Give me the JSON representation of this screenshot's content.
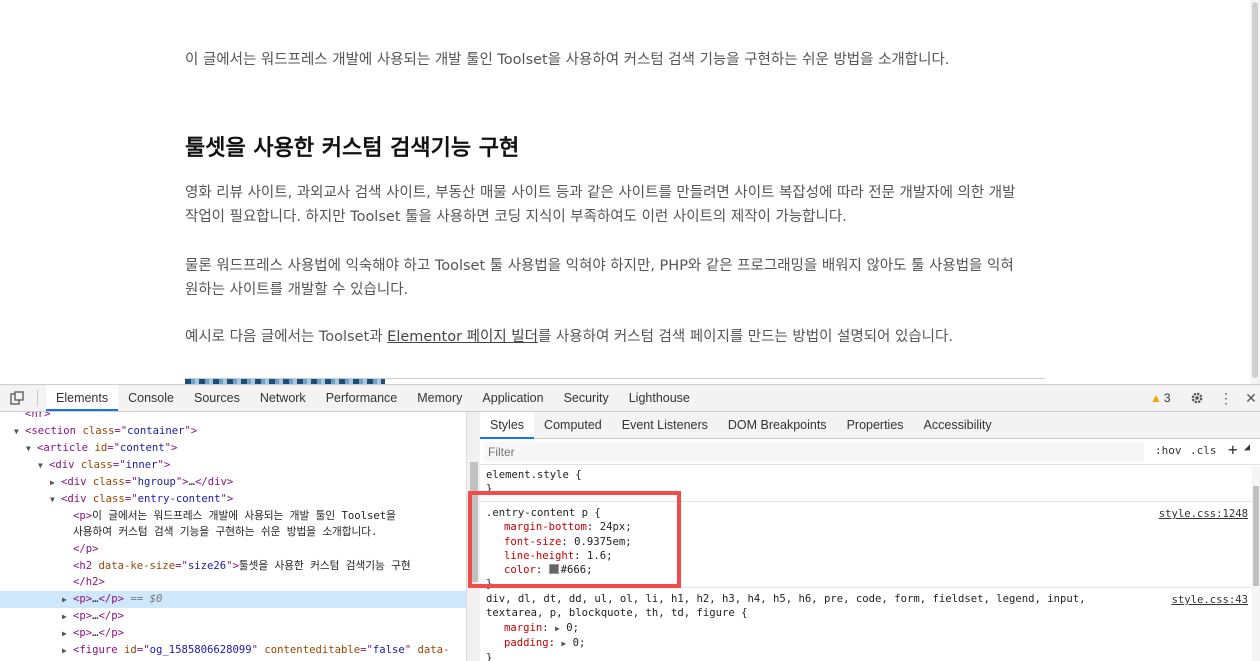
{
  "page": {
    "intro": "이 글에서는 워드프레스 개발에 사용되는 개발 툴인 Toolset을 사용하여 커스텀 검색 기능을 구현하는 쉬운 방법을 소개합니다.",
    "heading": "툴셋을 사용한 커스텀 검색기능 구현",
    "p1_line1": "영화 리뷰 사이트, 과외교사 검색 사이트, 부동산 매물 사이트 등과 같은 사이트를 만들려면 사이트 복잡성에 따라 전문 개발자에 의한 개발",
    "p1_line2": "작업이 필요합니다. 하지만 Toolset 툴을 사용하면 코딩 지식이 부족하여도 이런 사이트의 제작이 가능합니다.",
    "p2_line1": "물론 워드프레스 사용법에 익숙해야 하고 Toolset 툴 사용법을 익혀야 하지만, PHP와 같은 프로그래밍을 배워지 않아도 툴 사용법을 익혀",
    "p2_line2": "원하는 사이트를 개발할 수 있습니다.",
    "p3_before": "예시로 다음 글에서는 Toolset과 ",
    "p3_link": "Elementor 페이지 빌더",
    "p3_after": "를 사용하여 커스텀 검색 페이지를 만드는 방법이 설명되어 있습니다."
  },
  "devtools": {
    "tabs": [
      "Elements",
      "Console",
      "Sources",
      "Network",
      "Performance",
      "Memory",
      "Application",
      "Security",
      "Lighthouse"
    ],
    "active_tab": "Elements",
    "warning_count": "3",
    "icons": {
      "inspect": "inspect-icon",
      "device": "device-toolbar-icon",
      "warning": "warning-icon",
      "settings": "gear-icon",
      "more": "kebab-menu-icon",
      "close": "close-icon"
    },
    "tree": {
      "hr": "hr",
      "section_tag": "section",
      "section_attr": "class",
      "section_val": "container",
      "article_tag": "article",
      "article_attr": "id",
      "article_val": "content",
      "inner_tag": "div",
      "inner_attr": "class",
      "inner_val": "inner",
      "hgroup_tag": "div",
      "hgroup_attr": "class",
      "hgroup_val": "hgroup",
      "entry_tag": "div",
      "entry_attr": "class",
      "entry_val": "entry-content",
      "p_text_1": "이 글에서는 워드프레스 개발에 사용되는 개발 툴인 Toolset을",
      "p_text_2": "사용하여 커스텀 검색 기능을 구현하는 쉬운 방법을 소개합니다.",
      "h2_attr": "data-ke-size",
      "h2_val": "size26",
      "h2_text": "툴셋을 사용한 커스텀 검색기능 구현",
      "selected_marker": "== $0",
      "figure_attr1": "id",
      "figure_val1": "og_1585806628099",
      "figure_attr2": "contenteditable",
      "figure_val2": "false",
      "figure_attr3": "data-"
    },
    "sub_tabs": [
      "Styles",
      "Computed",
      "Event Listeners",
      "DOM Breakpoints",
      "Properties",
      "Accessibility"
    ],
    "active_sub_tab": "Styles",
    "filter_placeholder": "Filter",
    "hov": ":hov",
    "cls": ".cls",
    "plus": "+",
    "element_style": "element.style {",
    "entry_rule": {
      "selector": ".entry-content p {",
      "source": "style.css:1248",
      "props": [
        {
          "name": "margin-bottom",
          "value": "24px;"
        },
        {
          "name": "font-size",
          "value": "0.9375em;"
        },
        {
          "name": "line-height",
          "value": "1.6;"
        },
        {
          "name": "color",
          "value": "#666;"
        }
      ],
      "swatch_color": "#666666"
    },
    "reset_rule": {
      "selector_1": "div, dl, dt, dd, ul, ol, li, h1, h2, h3, h4, h5, h6, pre, code, form, fieldset, legend, input,",
      "selector_2": "textarea, p, blockquote, th, td, figure {",
      "source": "style.css:43",
      "props": [
        {
          "name": "margin",
          "value": "0;"
        },
        {
          "name": "padding",
          "value": "0;"
        }
      ]
    },
    "close_brace": "}"
  }
}
